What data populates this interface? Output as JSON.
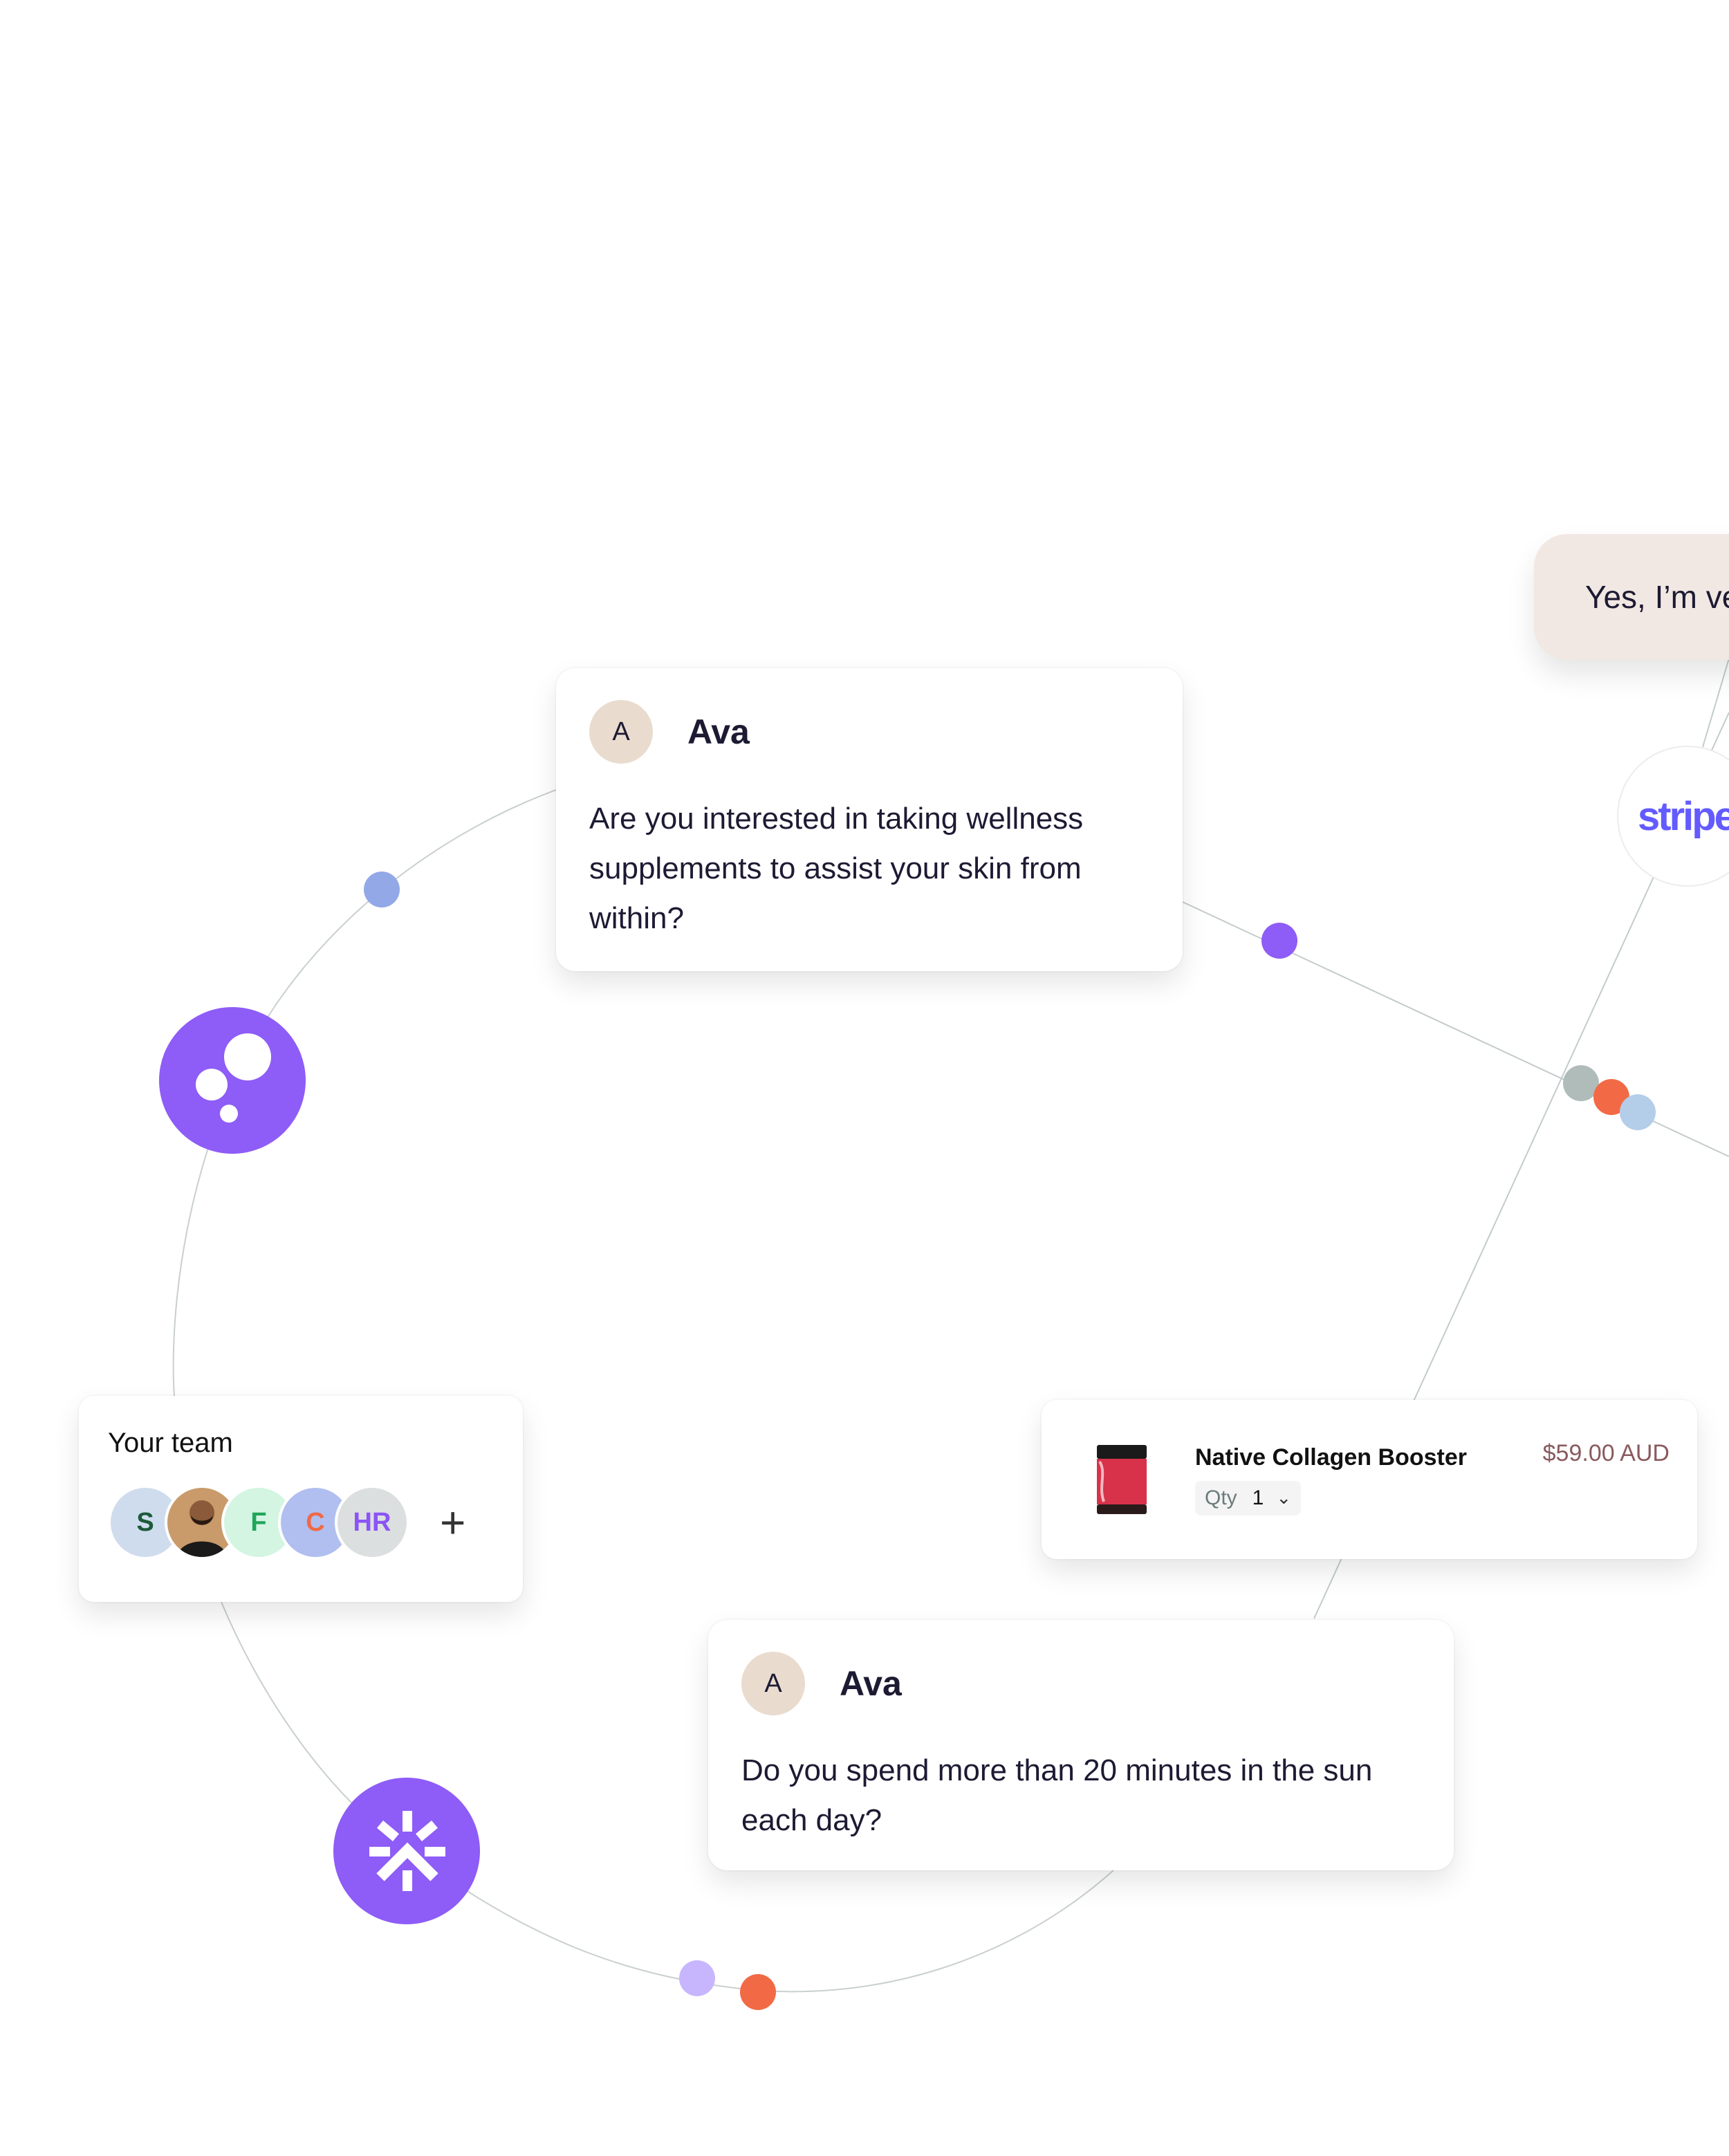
{
  "messages": [
    {
      "avatar_initial": "A",
      "name": "Ava",
      "text": "Are you interested in taking wellness supplements to assist your skin from within?"
    },
    {
      "avatar_initial": "A",
      "name": "Ava",
      "text": "Do you spend more than 20 minutes in the sun each day?"
    }
  ],
  "reply_bubble": {
    "text": "Yes, I’m very interested"
  },
  "stripe": {
    "logo_text": "stripe",
    "color": "#635bff"
  },
  "team": {
    "title": "Your team",
    "members": [
      {
        "label": "S",
        "bg": "#cfdcee",
        "fg": "#1d5a3a"
      },
      {
        "label": "",
        "bg": "#c99a6a",
        "fg": "#000000",
        "photo": true
      },
      {
        "label": "F",
        "bg": "#d3f5e2",
        "fg": "#20a65a"
      },
      {
        "label": "C",
        "bg": "#b0bff0",
        "fg": "#f06a45"
      },
      {
        "label": "HR",
        "bg": "#dcdfdf",
        "fg": "#8b55f5"
      }
    ],
    "add_label": "+"
  },
  "product": {
    "name": "Native Collagen Booster",
    "qty_label": "Qty",
    "qty_value": "1",
    "price": "$59.00 AUD"
  },
  "colors": {
    "brand_purple": "#8e5cf7",
    "orange": "#f26a45",
    "grey_dot": "#b0bcba",
    "light_blue_dot": "#b4cde9",
    "blue_dot": "#93a8e6",
    "lilac_dot": "#c7b6fd",
    "line": "#c3cccb"
  }
}
